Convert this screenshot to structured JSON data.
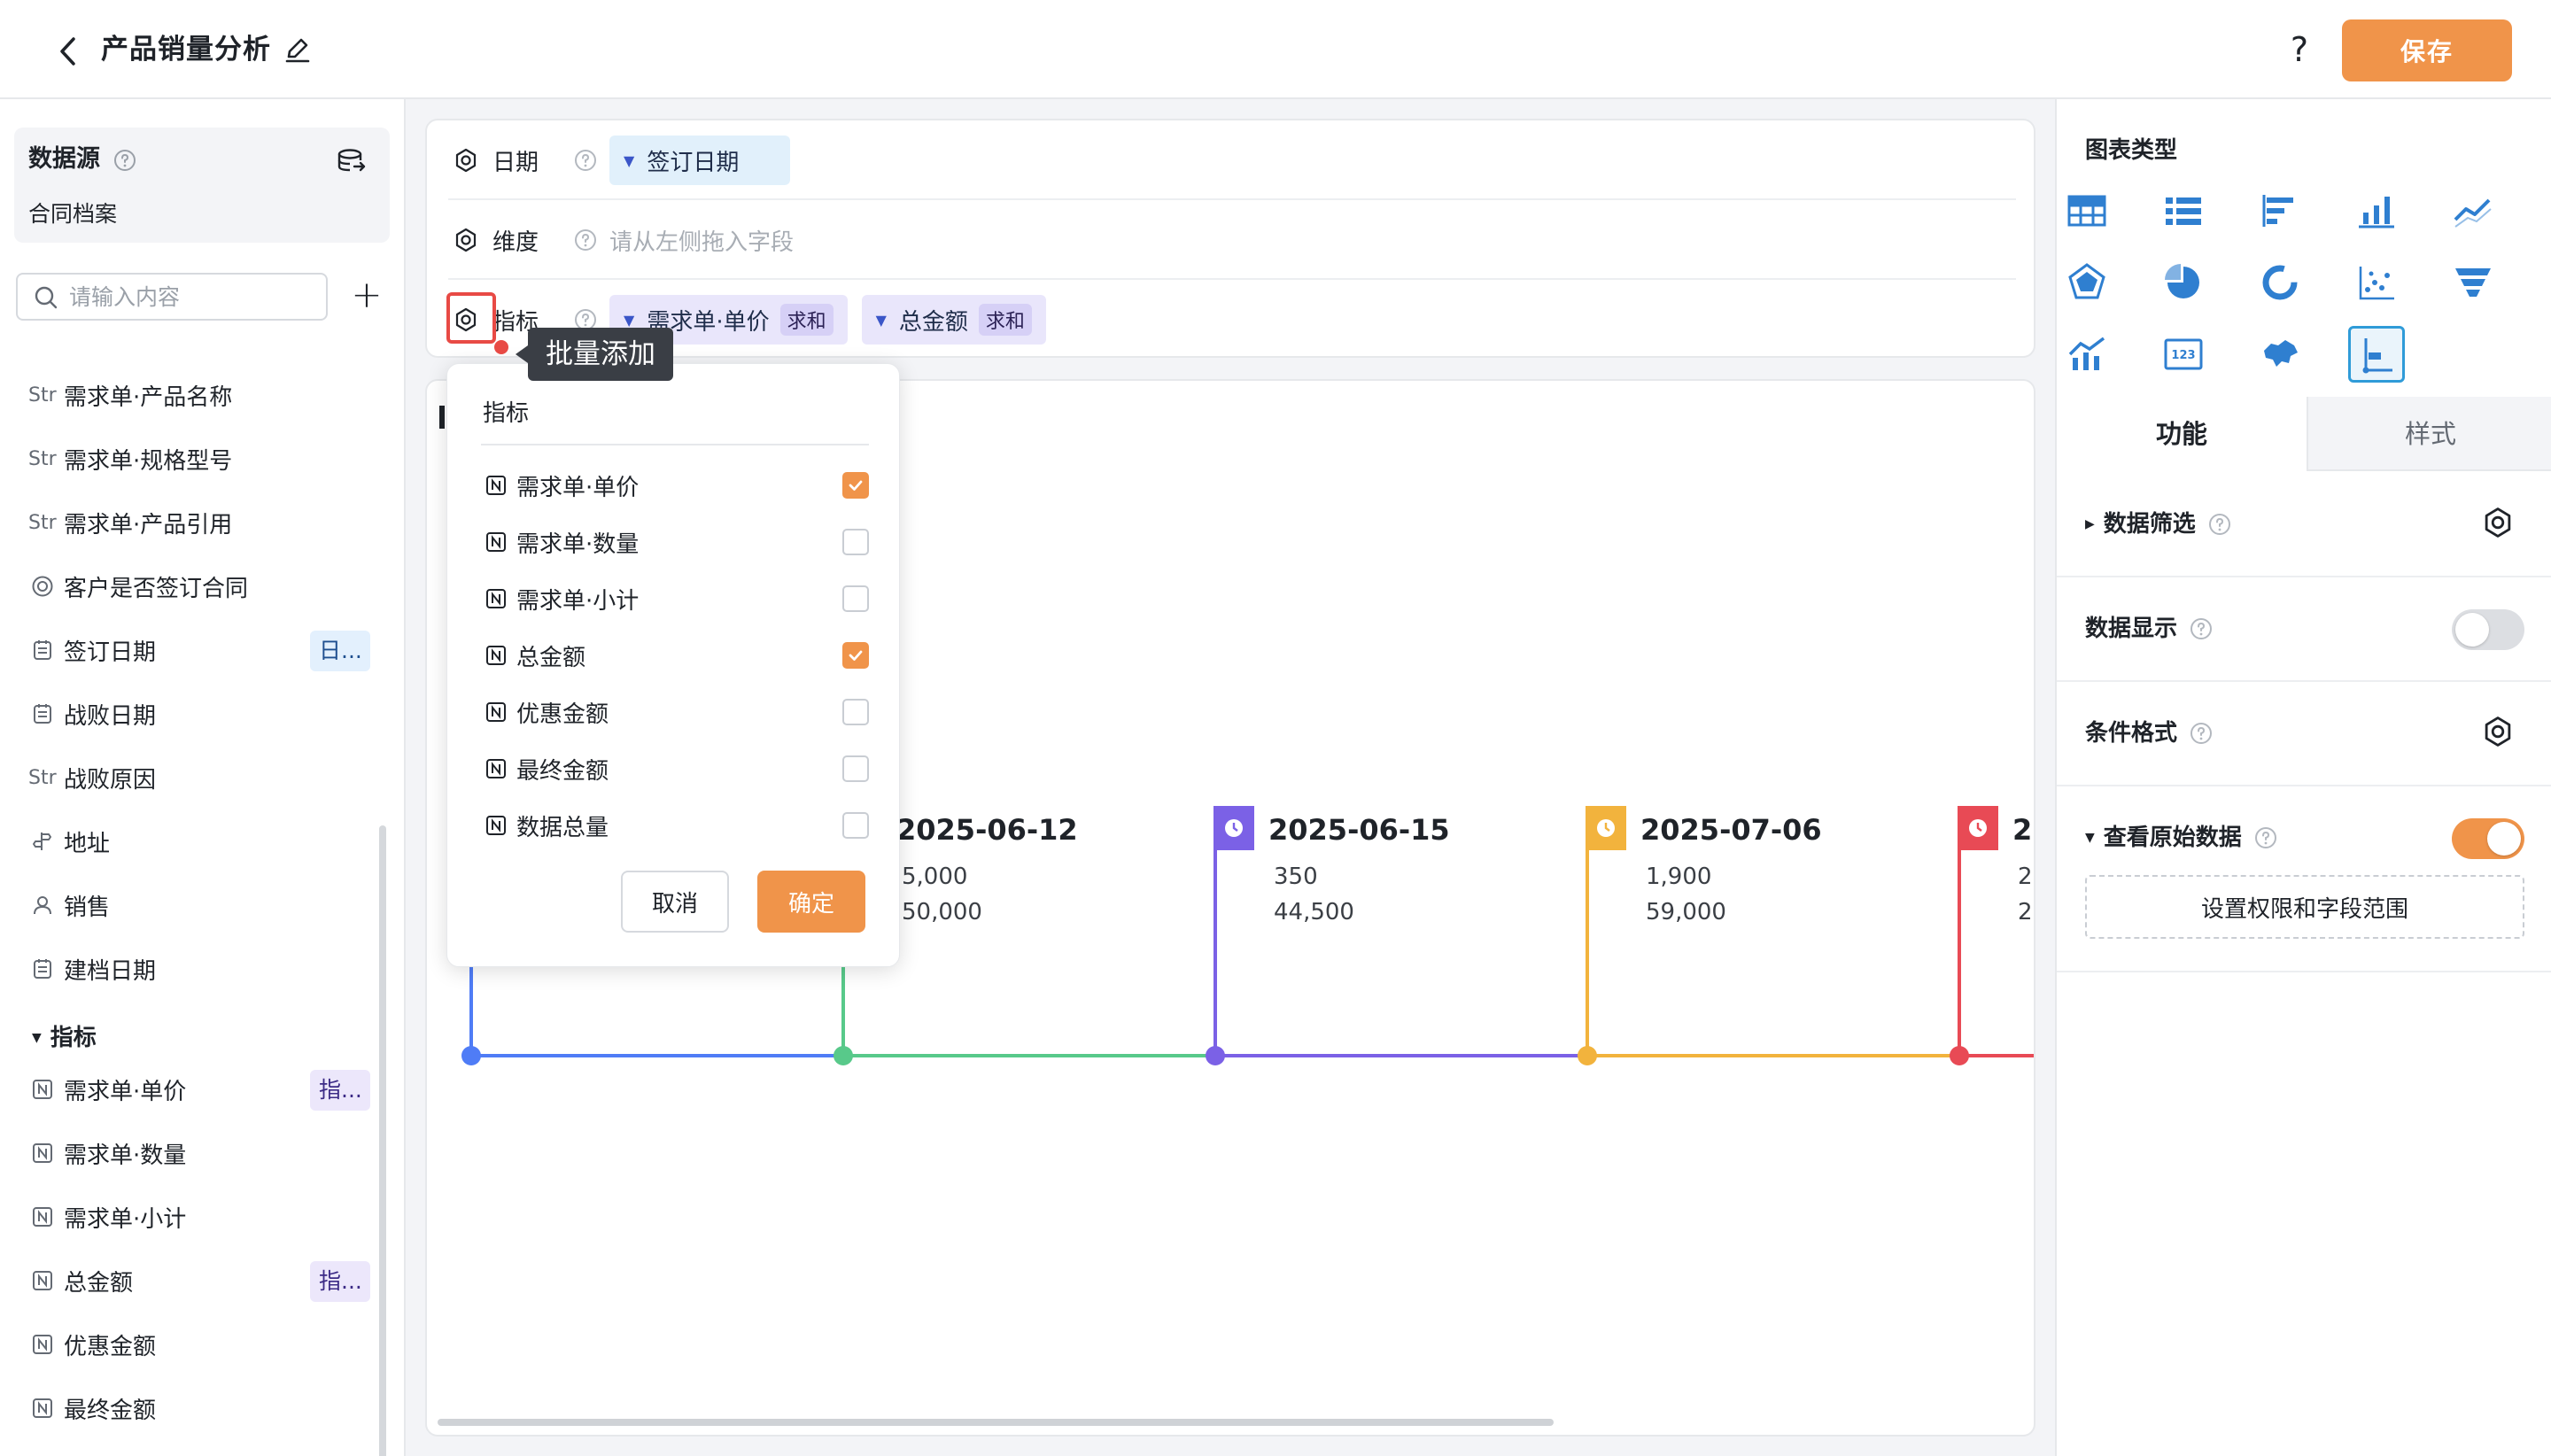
{
  "header": {
    "title": "产品销量分析",
    "save_label": "保存",
    "help_label": "?"
  },
  "left": {
    "datasource_title": "数据源",
    "datasource_name": "合同档案",
    "search_placeholder": "请输入内容",
    "add_label": "+",
    "fields": [
      {
        "type": "Str",
        "label": "需求单·产品名称",
        "badge": ""
      },
      {
        "type": "Str",
        "label": "需求单·规格型号",
        "badge": ""
      },
      {
        "type": "Str",
        "label": "需求单·产品引用",
        "badge": ""
      },
      {
        "type": "radio-icon",
        "label": "客户是否签订合同",
        "badge": ""
      },
      {
        "type": "date-icon",
        "label": "签订日期",
        "badge": "日..."
      },
      {
        "type": "date-icon",
        "label": "战败日期",
        "badge": ""
      },
      {
        "type": "Str",
        "label": "战败原因",
        "badge": ""
      },
      {
        "type": "location-icon",
        "label": "地址",
        "badge": ""
      },
      {
        "type": "user-icon",
        "label": "销售",
        "badge": ""
      },
      {
        "type": "date-icon",
        "label": "建档日期",
        "badge": ""
      }
    ],
    "metrics_group": "指标",
    "metrics": [
      {
        "label": "需求单·单价",
        "badge": "指..."
      },
      {
        "label": "需求单·数量",
        "badge": ""
      },
      {
        "label": "需求单·小计",
        "badge": ""
      },
      {
        "label": "总金额",
        "badge": "指..."
      },
      {
        "label": "优惠金额",
        "badge": ""
      },
      {
        "label": "最终金额",
        "badge": ""
      }
    ]
  },
  "config": {
    "date_label": "日期",
    "date_chip": "签订日期",
    "dimension_label": "维度",
    "dimension_placeholder": "请从左侧拖入字段",
    "metric_label": "指标",
    "metric_chips": [
      {
        "field": "需求单·单价",
        "agg": "求和"
      },
      {
        "field": "总金额",
        "agg": "求和"
      }
    ],
    "tooltip": "批量添加"
  },
  "popup": {
    "title": "指标",
    "items": [
      {
        "label": "需求单·单价",
        "checked": true
      },
      {
        "label": "需求单·数量",
        "checked": false
      },
      {
        "label": "需求单·小计",
        "checked": false
      },
      {
        "label": "总金额",
        "checked": true
      },
      {
        "label": "优惠金额",
        "checked": false
      },
      {
        "label": "最终金额",
        "checked": false
      },
      {
        "label": "数据总量",
        "checked": false
      }
    ],
    "cancel_label": "取消",
    "ok_label": "确定"
  },
  "chart_data": {
    "type": "timeline",
    "events": [
      {
        "date": "",
        "values": [
          "",
          ""
        ],
        "color": "#4f7cf6"
      },
      {
        "date": "2025-06-12",
        "values": [
          "5,000",
          "50,000"
        ],
        "color": "#58c98a"
      },
      {
        "date": "2025-06-15",
        "values": [
          "350",
          "44,500"
        ],
        "color": "#7b61e6"
      },
      {
        "date": "2025-07-06",
        "values": [
          "1,900",
          "59,000"
        ],
        "color": "#f2b33d"
      },
      {
        "date": "2",
        "values": [
          "2",
          "2"
        ],
        "color": "#e84a55"
      }
    ]
  },
  "right": {
    "chart_type_title": "图表类型",
    "chart_types": [
      "table-icon",
      "list-icon",
      "bar-horizontal-icon",
      "bar-vertical-icon",
      "line-icon",
      "radar-icon",
      "pie-icon",
      "donut-icon",
      "scatter-icon",
      "funnel-icon",
      "combo-icon",
      "number-card-icon",
      "map-icon",
      "timeline-icon"
    ],
    "selected_chart_type": "timeline-icon",
    "tab_function": "功能",
    "tab_style": "样式",
    "data_filter": "数据筛选",
    "data_display": "数据显示",
    "data_display_on": false,
    "conditional_format": "条件格式",
    "view_raw_data": "查看原始数据",
    "view_raw_data_on": true,
    "permission_button": "设置权限和字段范围"
  },
  "colors": {
    "accent": "#f0944a",
    "highlight": "#e84a45",
    "selected": "#2f9bd8"
  }
}
